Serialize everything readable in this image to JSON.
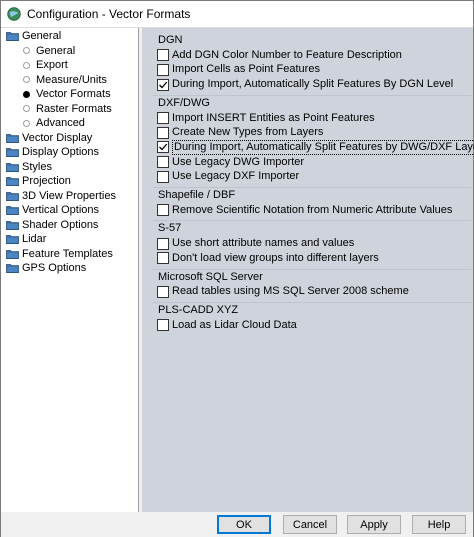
{
  "window": {
    "title": "Configuration - Vector Formats"
  },
  "tree": [
    {
      "label": "General",
      "kind": "folder",
      "level": 0
    },
    {
      "label": "General",
      "kind": "bullet",
      "level": 1
    },
    {
      "label": "Export",
      "kind": "bullet",
      "level": 1
    },
    {
      "label": "Measure/Units",
      "kind": "bullet",
      "level": 1
    },
    {
      "label": "Vector Formats",
      "kind": "bullet-selected",
      "level": 1
    },
    {
      "label": "Raster Formats",
      "kind": "bullet",
      "level": 1
    },
    {
      "label": "Advanced",
      "kind": "bullet",
      "level": 1
    },
    {
      "label": "Vector Display",
      "kind": "folder",
      "level": 0
    },
    {
      "label": "Display Options",
      "kind": "folder",
      "level": 0
    },
    {
      "label": "Styles",
      "kind": "folder",
      "level": 0
    },
    {
      "label": "Projection",
      "kind": "folder",
      "level": 0
    },
    {
      "label": "3D View Properties",
      "kind": "folder",
      "level": 0
    },
    {
      "label": "Vertical Options",
      "kind": "folder",
      "level": 0
    },
    {
      "label": "Shader Options",
      "kind": "folder",
      "level": 0
    },
    {
      "label": "Lidar",
      "kind": "folder",
      "level": 0
    },
    {
      "label": "Feature Templates",
      "kind": "folder",
      "level": 0
    },
    {
      "label": "GPS Options",
      "kind": "folder",
      "level": 0
    }
  ],
  "sections": [
    {
      "title": "DGN",
      "options": [
        {
          "label": "Add DGN Color Number to Feature Description",
          "checked": false
        },
        {
          "label": "Import Cells as Point Features",
          "checked": false
        },
        {
          "label": "During Import, Automatically Split Features By DGN Level",
          "checked": true
        }
      ]
    },
    {
      "title": "DXF/DWG",
      "options": [
        {
          "label": "Import INSERT Entities as Point Features",
          "checked": false
        },
        {
          "label": "Create New Types from Layers",
          "checked": false
        },
        {
          "label": "During Import, Automatically Split Features by DWG/DXF Layer",
          "checked": true,
          "focused": true
        },
        {
          "label": "Use Legacy DWG Importer",
          "checked": false
        },
        {
          "label": "Use Legacy DXF Importer",
          "checked": false
        }
      ]
    },
    {
      "title": "Shapefile / DBF",
      "options": [
        {
          "label": "Remove Scientific Notation from Numeric Attribute Values",
          "checked": false
        }
      ]
    },
    {
      "title": "S-57",
      "options": [
        {
          "label": "Use short attribute names and values",
          "checked": false
        },
        {
          "label": "Don't load view groups into different layers",
          "checked": false
        }
      ]
    },
    {
      "title": "Microsoft SQL Server",
      "options": [
        {
          "label": "Read tables using MS SQL Server 2008 scheme",
          "checked": false
        }
      ]
    },
    {
      "title": "PLS-CADD XYZ",
      "options": [
        {
          "label": "Load as Lidar Cloud Data",
          "checked": false
        }
      ]
    }
  ],
  "buttons": {
    "ok": "OK",
    "cancel": "Cancel",
    "apply": "Apply",
    "help": "Help"
  }
}
